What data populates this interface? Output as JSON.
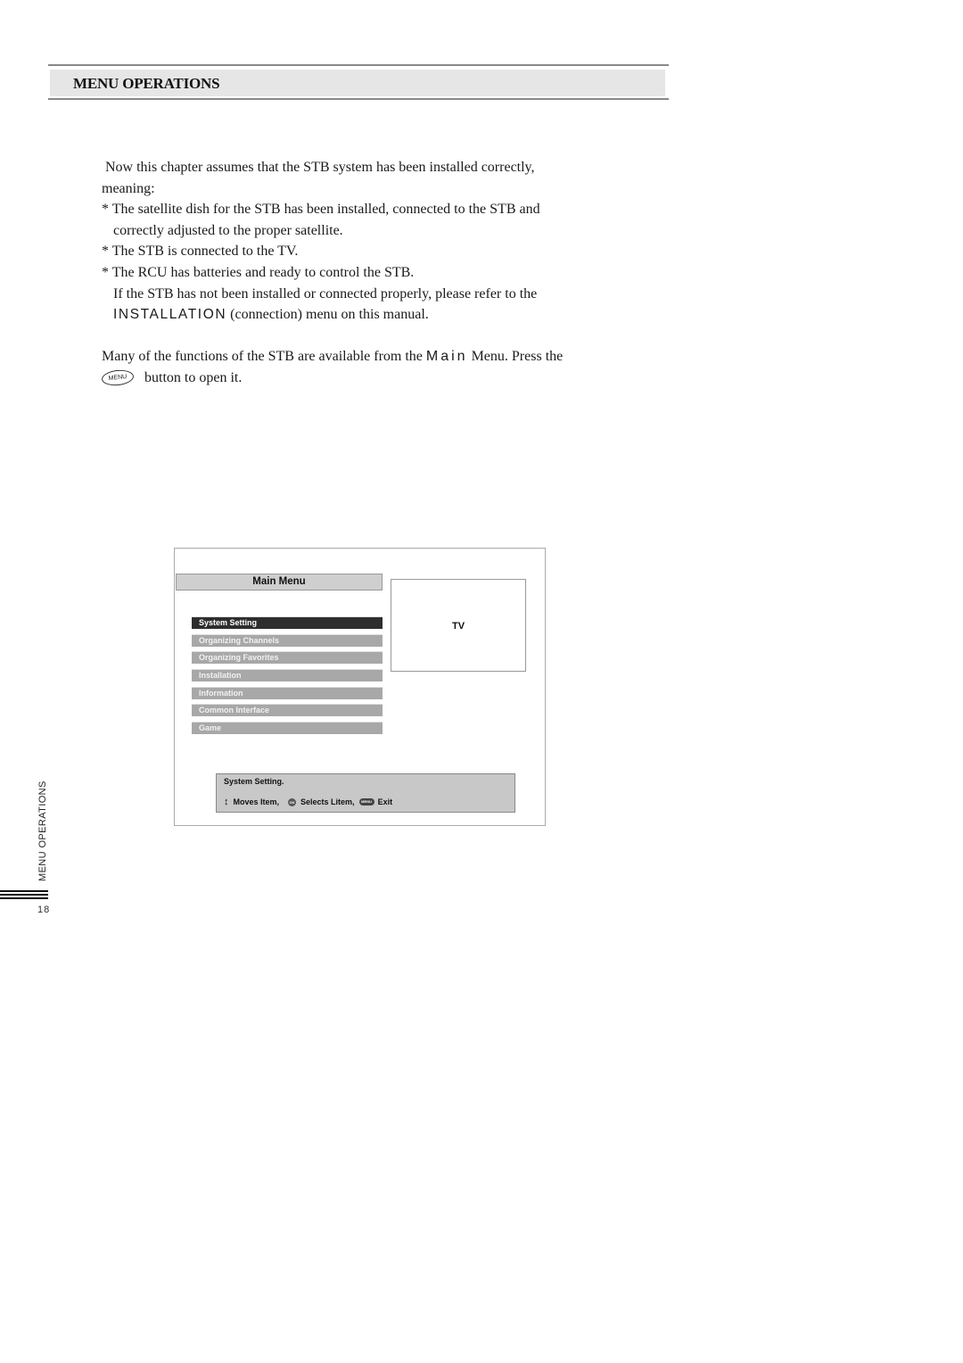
{
  "header": {
    "title": "MENU OPERATIONS"
  },
  "intro": {
    "line1": "Now this chapter assumes that the STB system has been installed correctly,",
    "line2": "meaning:",
    "bullet1a": "* The satellite dish for the STB has been installed, connected to the STB and",
    "bullet1b": "correctly adjusted to the proper satellite.",
    "bullet2": "* The STB is connected to the TV.",
    "bullet3": "* The RCU has batteries and ready to control the STB.",
    "note_a": "If the STB has not been installed or connected properly, please refer to the",
    "note_b_keyword": "INSTALLATION",
    "note_b_rest": " (connection) menu on this manual."
  },
  "main_para": {
    "line1_pre": "Many of the functions of the STB are available from the ",
    "line1_keyword": "Main",
    "line1_post": " Menu. Press the",
    "menu_button_icon_label": "MENU",
    "line2": "button to open it."
  },
  "screen": {
    "title": "Main Menu",
    "items": [
      {
        "label": "System Setting",
        "selected": true
      },
      {
        "label": "Organizing Channels",
        "selected": false
      },
      {
        "label": "Organizing Favorites",
        "selected": false
      },
      {
        "label": "Installation",
        "selected": false
      },
      {
        "label": "Information",
        "selected": false
      },
      {
        "label": "Common Interface",
        "selected": false
      },
      {
        "label": "Game",
        "selected": false
      }
    ],
    "tv_label": "TV",
    "help": {
      "title": "System Setting.",
      "updown_icon": "↕",
      "moves": "Moves Item,",
      "ok_icon": "OK",
      "selects": "Selects Litem,",
      "menu_icon": "MENU",
      "exit": "Exit"
    }
  },
  "side": {
    "section": "MENU OPERATIONS",
    "page": "18"
  }
}
